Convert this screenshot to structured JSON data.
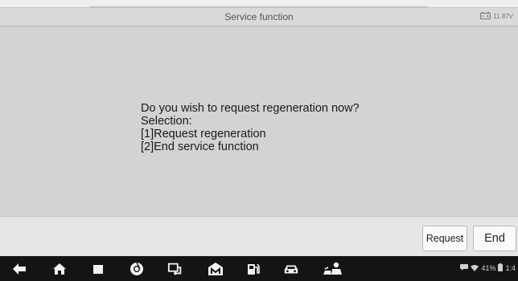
{
  "window": {
    "title": "Service function",
    "voltage": "11.87V"
  },
  "dialog": {
    "lines": [
      "Do you wish to request regeneration now?",
      "Selection:",
      "[1]Request regeneration",
      "[2]End service function"
    ]
  },
  "actions": {
    "request_label": "Request",
    "end_label": "End"
  },
  "navbar": {
    "icons": [
      "back-icon",
      "home-icon",
      "recent-apps-icon",
      "chrome-icon",
      "vci-connect-icon",
      "autel-m-icon",
      "fuel-icon",
      "car-icon",
      "mechanic-icon"
    ],
    "battery_percent": "41%",
    "time": "1:4"
  },
  "colors": {
    "content_bg": "#d3d3d3",
    "titlebar_bg": "#dadada",
    "actionbar_bg": "#e6e6e6",
    "navbar_bg": "#141414"
  }
}
